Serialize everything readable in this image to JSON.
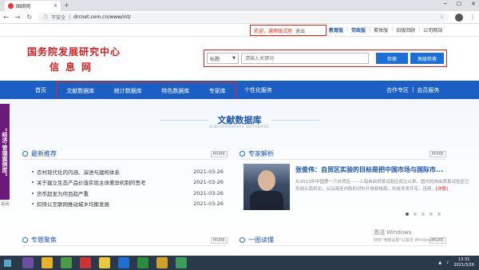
{
  "browser": {
    "tab_title": "国研网",
    "url_security": "不安全",
    "url": "drcnet.com.cn/www/int/"
  },
  "toplinks": {
    "welcome": "欢迎，通用版试用",
    "logout": "退出",
    "edu": "教育版",
    "party": "党政版",
    "traditional": "繁体版",
    "old": "旧版回顾",
    "company": "公司网站"
  },
  "header": {
    "logo_line1": "国务院发展研究中心",
    "logo_line2": "信息网",
    "search_category": "标题",
    "search_placeholder": "请输入关键词",
    "search_button": "检索",
    "advanced_button": "高级检索"
  },
  "nav": {
    "home": "首页",
    "items": [
      "文献数据库",
      "统计数据库",
      "特色数据库",
      "专家库"
    ],
    "personal": "个性化服务",
    "cooperation": "合作专区",
    "member": "会员服务"
  },
  "section": {
    "title": "文献数据库",
    "subtitle": "BIBLIOGRAPHIC DATABASE"
  },
  "side_banner": {
    "text": "“经济·管理案例库”",
    "close": "关闭"
  },
  "latest": {
    "heading": "最新推荐",
    "more": "MORE",
    "items": [
      {
        "title": "农村现代化的内涵、演进与建构体系",
        "date": "2021-03-26"
      },
      {
        "title": "关于建立生态产品价值实现主体差异机制的思考",
        "date": "2021-03-26"
      },
      {
        "title": "货币超发为何目趋严重",
        "date": "2021-03-26"
      },
      {
        "title": "扣快以互联网推动城乡均衡发展",
        "date": "2021-03-26"
      }
    ]
  },
  "expert": {
    "heading": "专家解析",
    "more": "MORE",
    "title": "张俊伟：自贸区实验的目标是把中国市场与国际市...",
    "desc": "从2013年中国第一个自贸区——上海自由贸易试验区成立以来，国内的自由贸易试验区已形成从南到北、从沿海至内陆的对外开放新格局，形成多类开花、连续...",
    "detail": "[详情]"
  },
  "bottom": {
    "left_heading": "专题聚焦",
    "right_heading": "一图读懂",
    "more": "MORE"
  },
  "watermark": {
    "line1": "激活 Windows",
    "line2": "转到\"电脑设置\"以激活 Windows。"
  },
  "taskbar": {
    "time": "13:31",
    "date": "2021/3/26"
  },
  "colors": {
    "brand_red": "#d42222",
    "nav_blue": "#1b5fc5",
    "highlight_red": "#e21"
  }
}
